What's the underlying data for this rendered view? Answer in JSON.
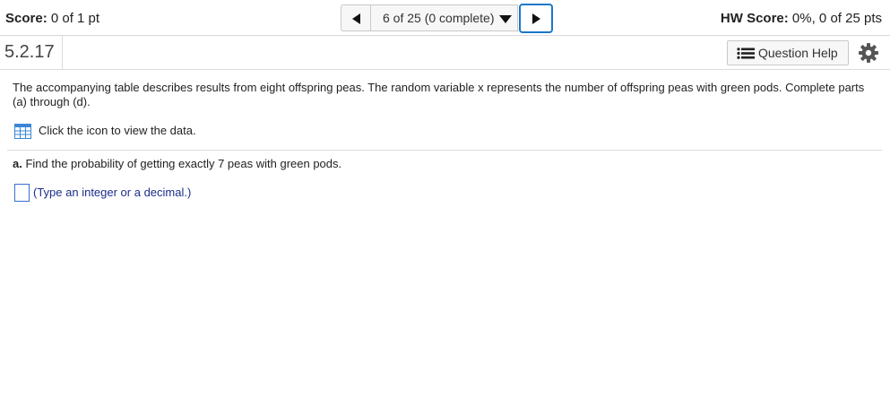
{
  "header": {
    "score_label": "Score:",
    "score_value": "0 of 1 pt",
    "nav_position": "6 of 25 (0 complete)",
    "hw_score_label": "HW Score:",
    "hw_score_value": "0%, 0 of 25 pts"
  },
  "question": {
    "number": "5.2.17",
    "help_label": "Question Help",
    "text": "The accompanying table describes results from eight offspring peas. The random variable x represents the number of offspring peas with green pods. Complete parts (a) through (d).",
    "data_link": "Click the icon to view the data.",
    "part_a_label": "a.",
    "part_a_text": "Find the probability of getting exactly 7 peas with green pods.",
    "answer_value": "",
    "answer_hint": "(Type an integer or a decimal.)"
  },
  "colors": {
    "accent": "#1b77c8",
    "hint_text": "#1d2f8c",
    "table_icon": "#3a87d6"
  },
  "icons": [
    "previous-triangle-icon",
    "dropdown-triangle-icon",
    "next-triangle-icon",
    "list-icon",
    "gear-icon",
    "table-icon"
  ]
}
